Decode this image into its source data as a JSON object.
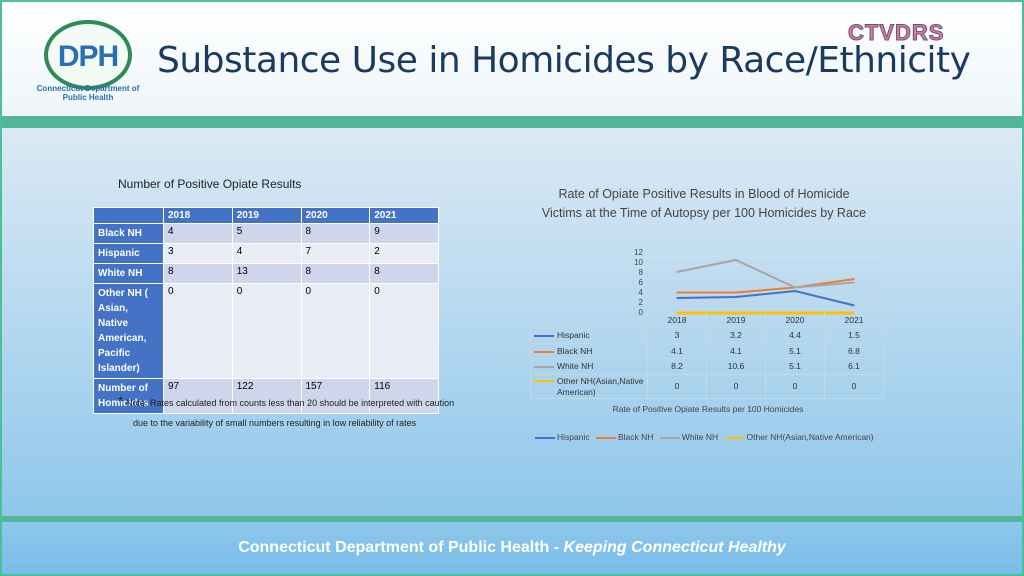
{
  "header": {
    "title": "Substance Use in Homicides by Race/Ethnicity",
    "logo_text": "DPH",
    "logo_subtext": "Connecticut Department of Public Health",
    "partner_logo": "CTVDRS"
  },
  "counts_table": {
    "caption": "Number of Positive Opiate Results",
    "columns": [
      "2018",
      "2019",
      "2020",
      "2021"
    ],
    "rows": [
      {
        "label": "Black NH",
        "values": [
          "4",
          "5",
          "8",
          "9"
        ]
      },
      {
        "label": "Hispanic",
        "values": [
          "3",
          "4",
          "7",
          "2"
        ]
      },
      {
        "label": "White NH",
        "values": [
          "8",
          "13",
          "8",
          "8"
        ]
      },
      {
        "label": "Other NH ( Asian, Native American, Pacific Islander)",
        "values": [
          "0",
          "0",
          "0",
          "0"
        ]
      },
      {
        "label": "Number of Homicides",
        "values": [
          "97",
          "122",
          "157",
          "116"
        ]
      }
    ]
  },
  "notes": {
    "star": "*",
    "line1": "Note: Rates calculated  from counts less than 20 should be interpreted with caution",
    "line2": "due to the variability of small numbers resulting in low reliability of rates"
  },
  "chart_data": {
    "type": "line",
    "title": "Rate of Opiate Positive Results in Blood of Homicide Victims at the Time of Autopsy per 100 Homicides by Race",
    "xlabel": "Rate of Positive Opiate Results per 100 Homicides",
    "ylabel": "",
    "categories": [
      "2018",
      "2019",
      "2020",
      "2021"
    ],
    "ylim": [
      0,
      12
    ],
    "yticks": [
      "0",
      "2",
      "4",
      "6",
      "8",
      "10",
      "12"
    ],
    "series": [
      {
        "name": "Hispanic",
        "values": [
          3,
          3.2,
          4.4,
          1.5
        ],
        "color": "#4472c4"
      },
      {
        "name": "Black NH",
        "values": [
          4.1,
          4.1,
          5.1,
          6.8
        ],
        "color": "#ed7d31"
      },
      {
        "name": "White NH",
        "values": [
          8.2,
          10.6,
          5.1,
          6.1
        ],
        "color": "#a5a5a5"
      },
      {
        "name": "Other NH(Asian,Native American)",
        "values": [
          0,
          0,
          0,
          0
        ],
        "color": "#ffc000"
      }
    ],
    "table_labels": {
      "Hispanic": "Hispanic",
      "Black NH": "Black NH",
      "White NH": "White NH",
      "Other NH(Asian,Native American)": "Other NH(Asian,Native American)"
    },
    "grid": true,
    "legend": "bottom"
  },
  "footer": {
    "text": "Connecticut Department of Public Health  - ",
    "tagline": "Keeping Connecticut Healthy"
  }
}
